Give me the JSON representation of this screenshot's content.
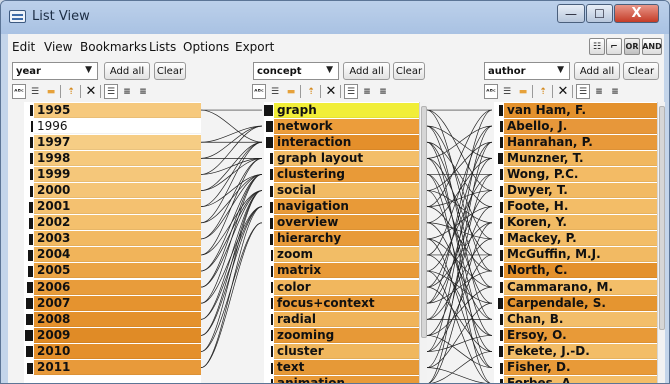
{
  "window": {
    "title": "List View",
    "buttons": {
      "minimize": "—",
      "maximize": "☐",
      "close": "X"
    }
  },
  "menu": [
    "Edit",
    "View",
    "Bookmarks",
    "Lists",
    "Options",
    "Export"
  ],
  "toolbar": {
    "or_label": "OR",
    "and_label": "AND"
  },
  "panels": [
    {
      "facet": "year",
      "add_all_label": "Add all",
      "clear_label": "Clear",
      "items": [
        {
          "label": "1995",
          "selected": true,
          "weight": 0.25,
          "color": "#f6c97d"
        },
        {
          "label": "1996",
          "selected": false,
          "weight": 0.15,
          "color": "#ffffff"
        },
        {
          "label": "1997",
          "selected": true,
          "weight": 0.3,
          "color": "#f6cd85"
        },
        {
          "label": "1998",
          "selected": true,
          "weight": 0.3,
          "color": "#f6c97c"
        },
        {
          "label": "1999",
          "selected": true,
          "weight": 0.3,
          "color": "#f5c77a"
        },
        {
          "label": "2000",
          "selected": true,
          "weight": 0.3,
          "color": "#f5c577"
        },
        {
          "label": "2001",
          "selected": true,
          "weight": 0.35,
          "color": "#f4c170"
        },
        {
          "label": "2002",
          "selected": true,
          "weight": 0.35,
          "color": "#f4c06d"
        },
        {
          "label": "2003",
          "selected": true,
          "weight": 0.4,
          "color": "#f2b961"
        },
        {
          "label": "2004",
          "selected": true,
          "weight": 0.45,
          "color": "#f1b45a"
        },
        {
          "label": "2005",
          "selected": true,
          "weight": 0.55,
          "color": "#eba445"
        },
        {
          "label": "2006",
          "selected": true,
          "weight": 0.6,
          "color": "#e89c3b"
        },
        {
          "label": "2007",
          "selected": true,
          "weight": 0.7,
          "color": "#e5932f"
        },
        {
          "label": "2008",
          "selected": true,
          "weight": 0.75,
          "color": "#e4912c"
        },
        {
          "label": "2009",
          "selected": true,
          "weight": 0.85,
          "color": "#e08b26"
        },
        {
          "label": "2010",
          "selected": true,
          "weight": 0.8,
          "color": "#e48f2b"
        },
        {
          "label": "2011",
          "selected": true,
          "weight": 0.65,
          "color": "#e89a3a"
        }
      ]
    },
    {
      "facet": "concept",
      "add_all_label": "Add all",
      "clear_label": "Clear",
      "items": [
        {
          "label": "graph",
          "selected": true,
          "weight": 1.0,
          "color": "#f1ee38"
        },
        {
          "label": "network",
          "selected": true,
          "weight": 0.8,
          "color": "#ec9d3b"
        },
        {
          "label": "interaction",
          "selected": true,
          "weight": 0.8,
          "color": "#e48f2b"
        },
        {
          "label": "graph layout",
          "selected": true,
          "weight": 0.2,
          "color": "#f3be69"
        },
        {
          "label": "clustering",
          "selected": true,
          "weight": 0.25,
          "color": "#e89a38"
        },
        {
          "label": "social",
          "selected": true,
          "weight": 0.2,
          "color": "#f2bb63"
        },
        {
          "label": "navigation",
          "selected": true,
          "weight": 0.2,
          "color": "#e89a38"
        },
        {
          "label": "overview",
          "selected": true,
          "weight": 0.2,
          "color": "#e79a37"
        },
        {
          "label": "hierarchy",
          "selected": true,
          "weight": 0.2,
          "color": "#e89a38"
        },
        {
          "label": "zoom",
          "selected": true,
          "weight": 0.15,
          "color": "#f2bd66"
        },
        {
          "label": "matrix",
          "selected": true,
          "weight": 0.15,
          "color": "#e89a38"
        },
        {
          "label": "color",
          "selected": true,
          "weight": 0.15,
          "color": "#f1b75e"
        },
        {
          "label": "focus+context",
          "selected": true,
          "weight": 0.15,
          "color": "#e79937"
        },
        {
          "label": "radial",
          "selected": true,
          "weight": 0.15,
          "color": "#f0b45a"
        },
        {
          "label": "zooming",
          "selected": true,
          "weight": 0.15,
          "color": "#e79937"
        },
        {
          "label": "cluster",
          "selected": true,
          "weight": 0.15,
          "color": "#f0b75e"
        },
        {
          "label": "text",
          "selected": true,
          "weight": 0.15,
          "color": "#e69937"
        },
        {
          "label": "animation",
          "selected": true,
          "weight": 0.15,
          "color": "#e89a38"
        }
      ]
    },
    {
      "facet": "author",
      "add_all_label": "Add all",
      "clear_label": "Clear",
      "items": [
        {
          "label": "van Ham, F.",
          "selected": true,
          "weight": 0.35,
          "color": "#e4912c"
        },
        {
          "label": "Abello, J.",
          "selected": true,
          "weight": 0.3,
          "color": "#e7973a"
        },
        {
          "label": "Hanrahan, P.",
          "selected": true,
          "weight": 0.3,
          "color": "#e8993a"
        },
        {
          "label": "Munzner, T.",
          "selected": true,
          "weight": 0.45,
          "color": "#f1b75e"
        },
        {
          "label": "Wong, P.C.",
          "selected": true,
          "weight": 0.3,
          "color": "#f3bb65"
        },
        {
          "label": "Dwyer, T.",
          "selected": true,
          "weight": 0.3,
          "color": "#f2ba63"
        },
        {
          "label": "Foote, H.",
          "selected": true,
          "weight": 0.3,
          "color": "#f3bd67"
        },
        {
          "label": "Koren, Y.",
          "selected": true,
          "weight": 0.3,
          "color": "#f2bb64"
        },
        {
          "label": "Mackey, P.",
          "selected": true,
          "weight": 0.3,
          "color": "#f3bd67"
        },
        {
          "label": "McGuffin, M.J.",
          "selected": true,
          "weight": 0.3,
          "color": "#f2ba63"
        },
        {
          "label": "North, C.",
          "selected": true,
          "weight": 0.3,
          "color": "#e4912c"
        },
        {
          "label": "Cammarano, M.",
          "selected": true,
          "weight": 0.2,
          "color": "#f3be69"
        },
        {
          "label": "Carpendale, S.",
          "selected": true,
          "weight": 0.45,
          "color": "#e59530"
        },
        {
          "label": "Chan, B.",
          "selected": true,
          "weight": 0.2,
          "color": "#f3be69"
        },
        {
          "label": "Ersoy, O.",
          "selected": true,
          "weight": 0.2,
          "color": "#e89a38"
        },
        {
          "label": "Fekete, J.-D.",
          "selected": true,
          "weight": 0.35,
          "color": "#f3bd67"
        },
        {
          "label": "Fisher, D.",
          "selected": true,
          "weight": 0.2,
          "color": "#e89a38"
        },
        {
          "label": "Forbes, A.",
          "selected": true,
          "weight": 0.2,
          "color": "#f3bd67"
        }
      ]
    }
  ]
}
